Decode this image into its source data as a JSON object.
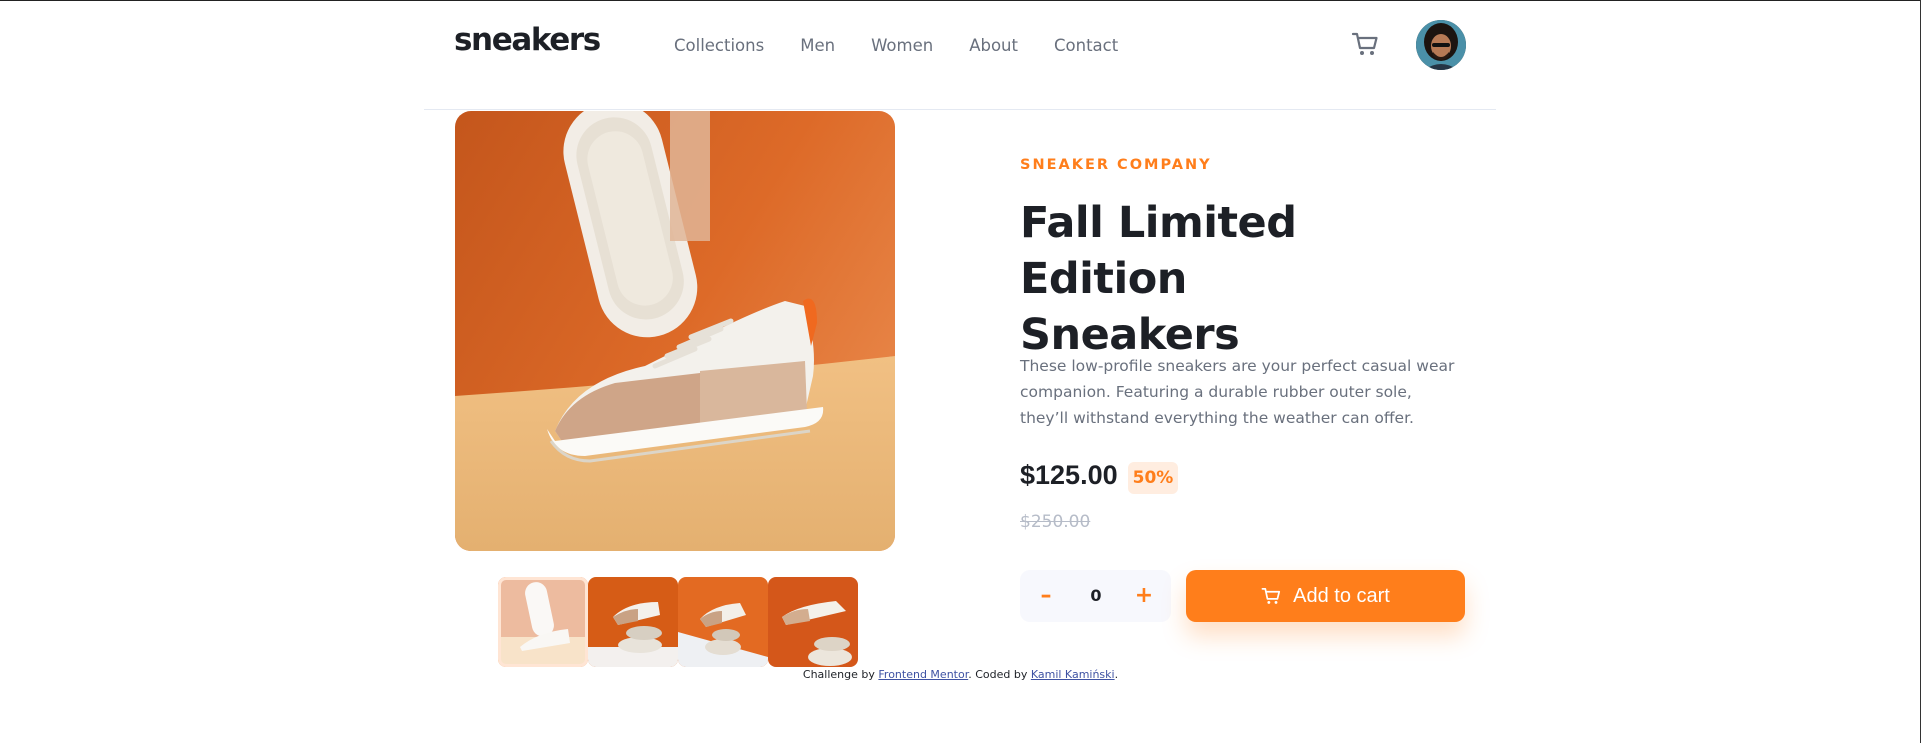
{
  "header": {
    "logo": "sneakers",
    "nav": [
      "Collections",
      "Men",
      "Women",
      "About",
      "Contact"
    ]
  },
  "icons": {
    "cart": "cart-icon",
    "avatar": "avatar",
    "minus": "minus-icon",
    "plus": "plus-icon"
  },
  "gallery": {
    "selected_index": 0,
    "thumbnail_count": 4
  },
  "product": {
    "company": "SNEAKER COMPANY",
    "title_line1": "Fall Limited Edition",
    "title_line2": "Sneakers",
    "description": "These low-profile sneakers are your perfect casual wear companion. Featuring a durable rubber outer sole, they’ll withstand everything the weather can offer.",
    "price": "$125.00",
    "discount": "50%",
    "old_price": "$250.00"
  },
  "cart": {
    "quantity": "0",
    "minus_label": "–",
    "plus_label": "+",
    "add_label": "Add to cart"
  },
  "attribution": {
    "prefix": "Challenge by",
    "link1": "Frontend Mentor",
    "middle": ". Coded by",
    "link2": "Kamil Kamiński",
    "suffix": "."
  },
  "colors": {
    "accent": "#ff7e1b",
    "accent_pale": "#ffede0",
    "text_dark": "#1d2026",
    "text_grey": "#69707d",
    "old_price": "#b6bcc8"
  }
}
